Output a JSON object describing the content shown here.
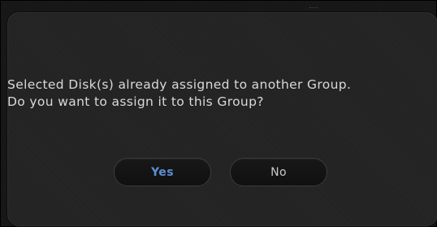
{
  "dialog": {
    "message_line1": "Selected Disk(s) already assigned to another Group.",
    "message_line2": "Do you want to assign it to this Group?",
    "yes_label": "Yes",
    "no_label": "No"
  },
  "colors": {
    "background": "#262626",
    "text": "#d9d9d9",
    "primary_button_text": "#5b8fd4",
    "button_background": "#131313"
  }
}
